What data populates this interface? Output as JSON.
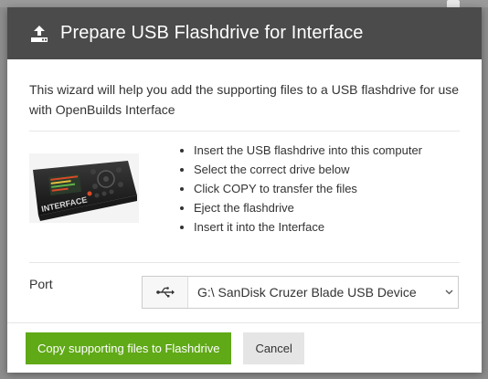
{
  "dialog": {
    "title": "Prepare USB Flashdrive for Interface",
    "header_icon": "upload-icon",
    "intro": "This wizard will help you add the supporting files to a USB flashdrive for use with OpenBuilds Interface",
    "device_image_label": "INTERFACE",
    "steps": [
      "Insert the USB flashdrive into this computer",
      "Select the correct drive below",
      "Click COPY to transfer the files",
      "Eject the flashdrive",
      "Insert it into the Interface"
    ],
    "port": {
      "label": "Port",
      "icon": "usb-icon",
      "selected": "G:\\ SanDisk Cruzer Blade USB Device"
    },
    "buttons": {
      "copy": "Copy supporting files to Flashdrive",
      "cancel": "Cancel"
    }
  },
  "colors": {
    "header_bg": "#4b4b4b",
    "primary_button": "#60a917",
    "cancel_button": "#e5e5e5",
    "overlay": "#8d8d8d"
  }
}
